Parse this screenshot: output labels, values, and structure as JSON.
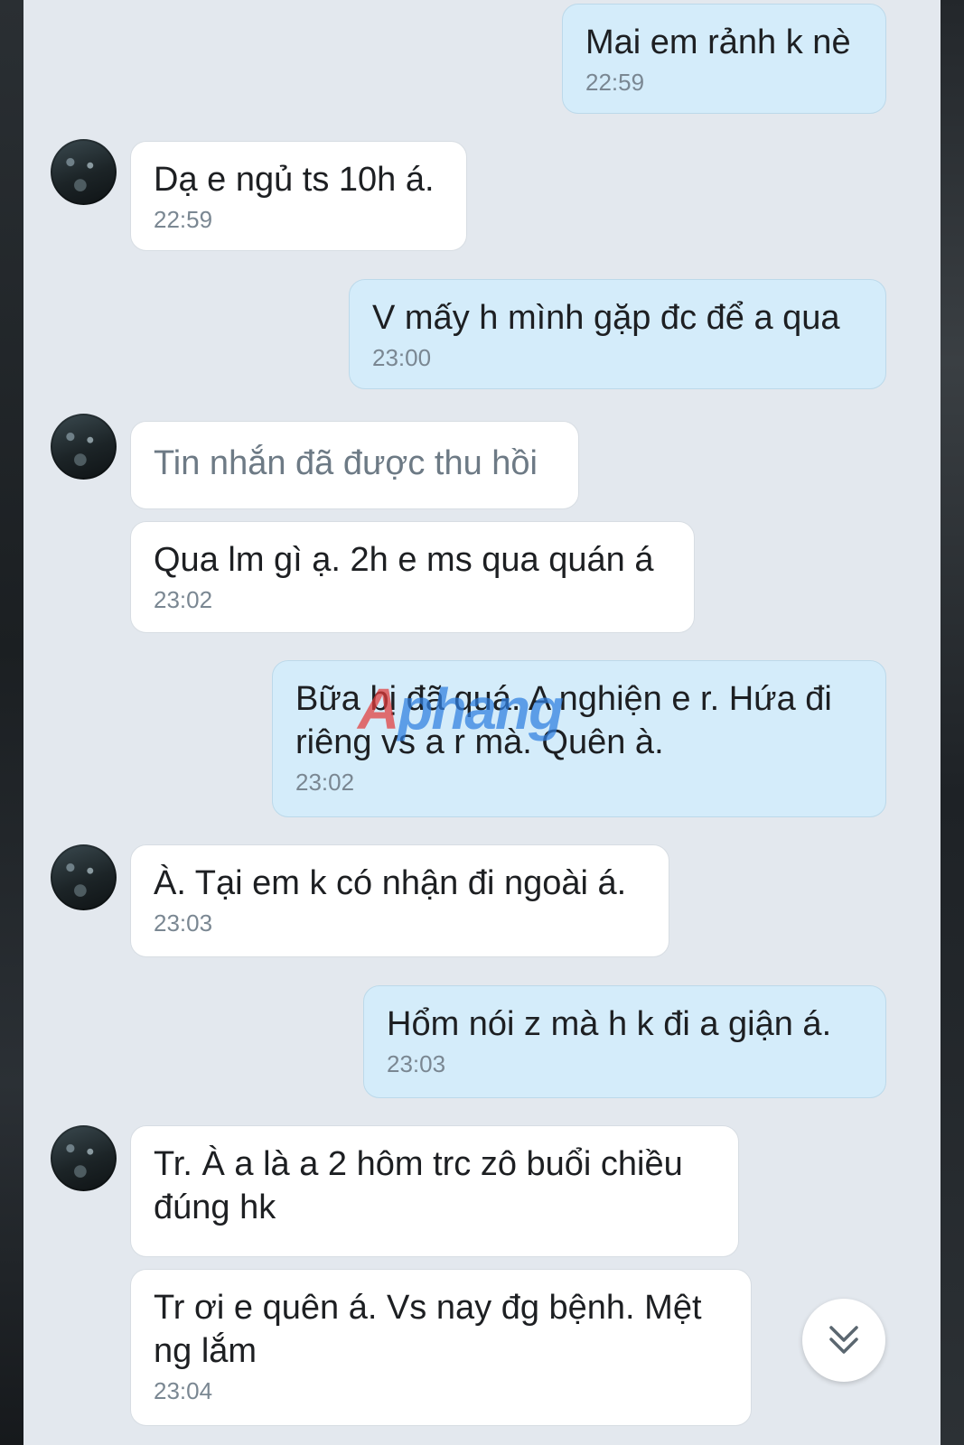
{
  "messages": [
    {
      "direction": "out",
      "text": "Mai em rảnh k nè",
      "time": "22:59"
    },
    {
      "direction": "in",
      "text": "Dạ e ngủ ts 10h á.",
      "time": "22:59"
    },
    {
      "direction": "out",
      "text": "V mấy h mình gặp đc để a qua",
      "time": "23:00"
    },
    {
      "direction": "in",
      "text": "Tin nhắn đã được thu hồi",
      "time": ""
    },
    {
      "direction": "in",
      "text": "Qua lm gì ạ. 2h e ms qua quán á",
      "time": "23:02"
    },
    {
      "direction": "out",
      "text": "Bữa bị đã quá. A nghiện e r. Hứa đi riêng vs a r mà. Quên à.",
      "time": "23:02"
    },
    {
      "direction": "in",
      "text": "À. Tại em k có nhận đi ngoài á.",
      "time": "23:03"
    },
    {
      "direction": "out",
      "text": "Hổm nói z mà h k đi a giận á.",
      "time": "23:03"
    },
    {
      "direction": "in",
      "text": "Tr. À a là a 2 hôm trc zô buổi chiều đúng hk",
      "time": ""
    },
    {
      "direction": "in",
      "text": "Tr ơi e quên á. Vs nay đg bệnh. Mệt ng lắm",
      "time": "23:04"
    }
  ],
  "watermark": {
    "first_letter": "A",
    "rest": "phang"
  },
  "icons": {
    "scroll_down": "chevron-double-down-icon",
    "avatar": "contact-avatar"
  },
  "colors": {
    "chat_background": "#e3e8ee",
    "incoming_bubble": "#ffffff",
    "outgoing_bubble": "#d4ecfa",
    "timestamp": "#7a8792"
  }
}
